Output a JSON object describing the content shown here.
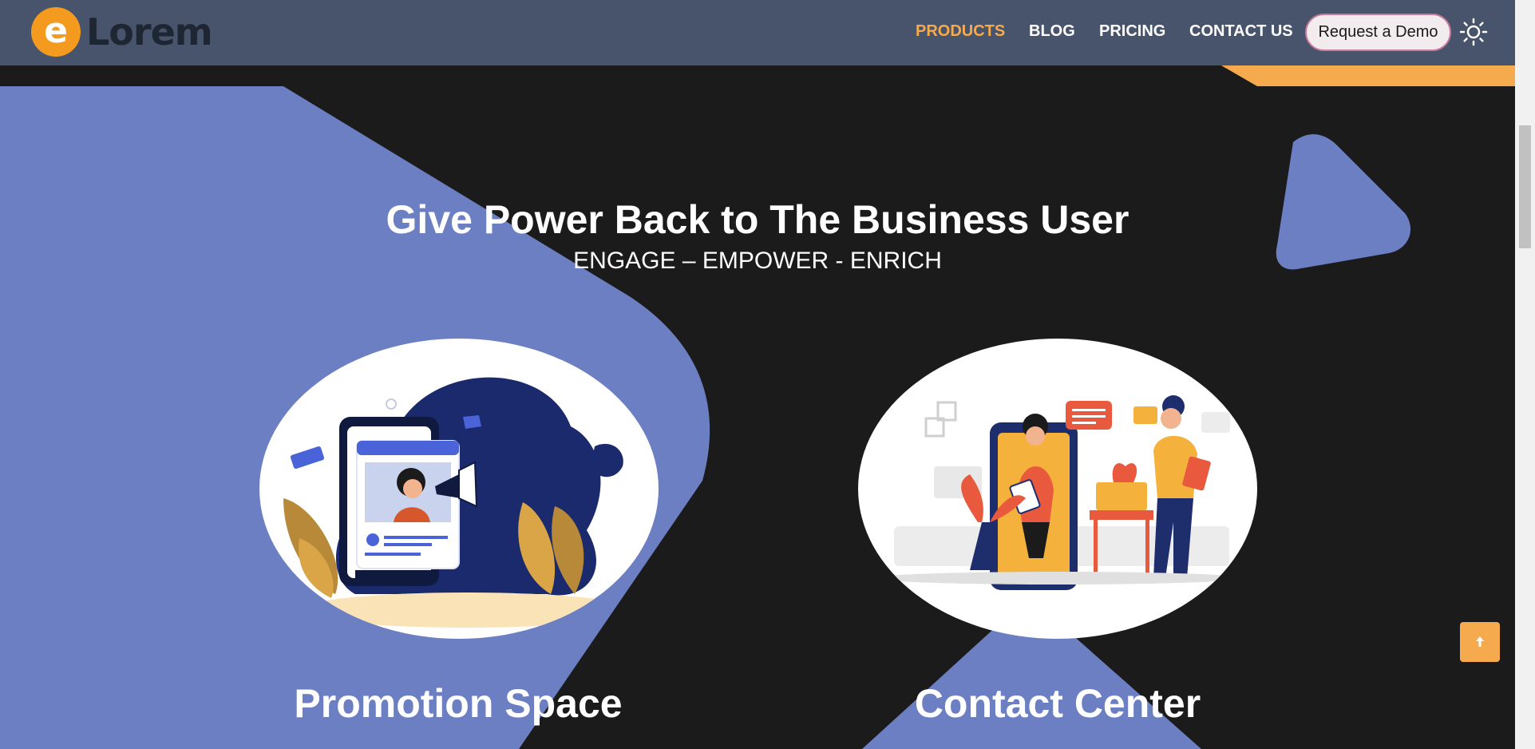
{
  "brand": {
    "name": "Lorem",
    "mark_letter": "e",
    "mark_color": "#f39a1f"
  },
  "nav": {
    "items": [
      {
        "label": "PRODUCTS",
        "active": true
      },
      {
        "label": "BLOG",
        "active": false
      },
      {
        "label": "PRICING",
        "active": false
      },
      {
        "label": "CONTACT US",
        "active": false
      }
    ],
    "demo_button": "Request a Demo",
    "theme_icon": "sun-icon"
  },
  "hero": {
    "title": "Give Power Back to The Business User",
    "subtitle": "ENGAGE – EMPOWER - ENRICH"
  },
  "cards": [
    {
      "title": "Promotion Space",
      "illustration": "megaphone-phone-illustration"
    },
    {
      "title": "Contact Center",
      "illustration": "customer-support-illustration"
    }
  ],
  "scroll_top_icon": "arrow-up-icon",
  "colors": {
    "header_bg": "#48546b",
    "page_bg": "#1b1b1b",
    "accent": "#f6aa4e",
    "shape_blue": "#6b7fc2"
  }
}
